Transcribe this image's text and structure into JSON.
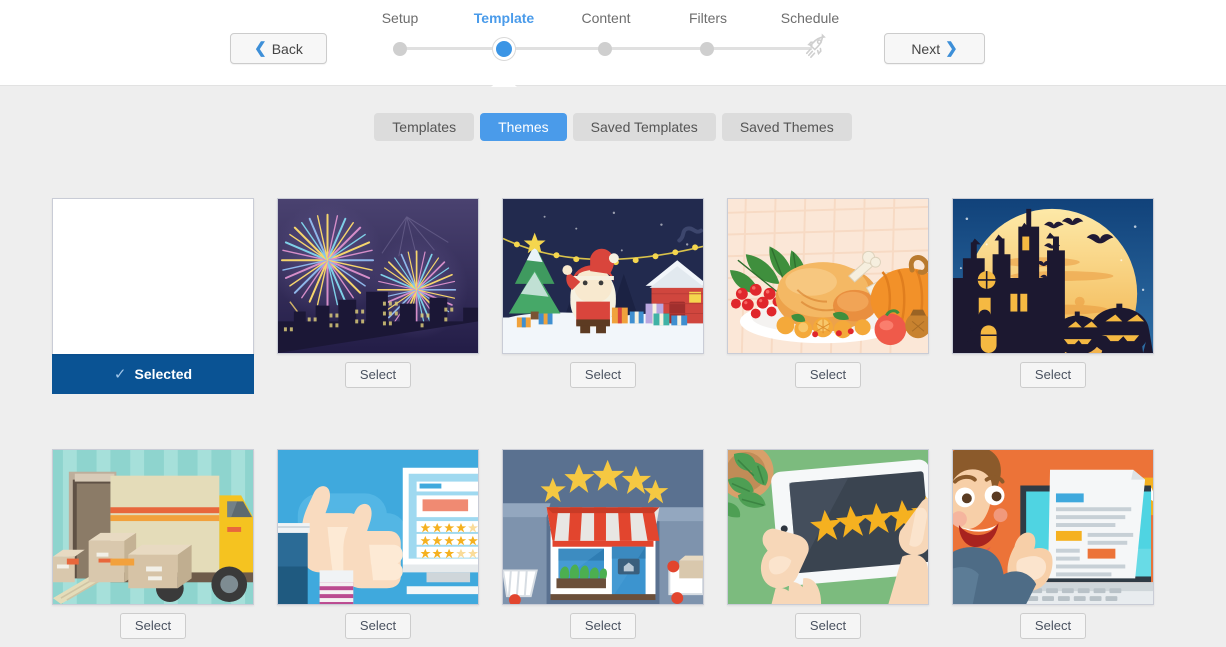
{
  "header": {
    "back_label": "Back",
    "next_label": "Next",
    "back_icon": "chevron-left-icon",
    "next_icon": "chevron-right-icon",
    "rocket_icon": "rocket-icon",
    "steps": [
      {
        "label": "Setup",
        "state": "inactive"
      },
      {
        "label": "Template",
        "state": "active"
      },
      {
        "label": "Content",
        "state": "inactive"
      },
      {
        "label": "Filters",
        "state": "inactive"
      },
      {
        "label": "Schedule",
        "state": "inactive"
      }
    ],
    "accent_color": "#4a9bea",
    "inactive_label_color": "#6d6d6d"
  },
  "tabs": [
    {
      "label": "Templates",
      "active": false
    },
    {
      "label": "Themes",
      "active": true
    },
    {
      "label": "Saved Templates",
      "active": false
    },
    {
      "label": "Saved Themes",
      "active": false
    }
  ],
  "selected_color": "#0a5394",
  "cards": [
    {
      "name": "blank-theme",
      "state": "selected",
      "action_label": "Selected",
      "check_icon": "check-icon",
      "art": "blank"
    },
    {
      "name": "fireworks-theme",
      "state": "unselected",
      "action_label": "Select",
      "art": "fireworks"
    },
    {
      "name": "christmas-theme",
      "state": "unselected",
      "action_label": "Select",
      "art": "christmas"
    },
    {
      "name": "thanksgiving-theme",
      "state": "unselected",
      "action_label": "Select",
      "art": "thanksgiving"
    },
    {
      "name": "halloween-theme",
      "state": "unselected",
      "action_label": "Select",
      "art": "halloween"
    },
    {
      "name": "delivery-theme",
      "state": "unselected",
      "action_label": "Select",
      "art": "delivery"
    },
    {
      "name": "thumbsup-review-theme",
      "state": "unselected",
      "action_label": "Select",
      "art": "thumbsup"
    },
    {
      "name": "storefront-rating-theme",
      "state": "unselected",
      "action_label": "Select",
      "art": "storefront"
    },
    {
      "name": "tablet-rating-theme",
      "state": "unselected",
      "action_label": "Select",
      "art": "tablet"
    },
    {
      "name": "laptop-review-theme",
      "state": "unselected",
      "action_label": "Select",
      "art": "laptop"
    }
  ]
}
